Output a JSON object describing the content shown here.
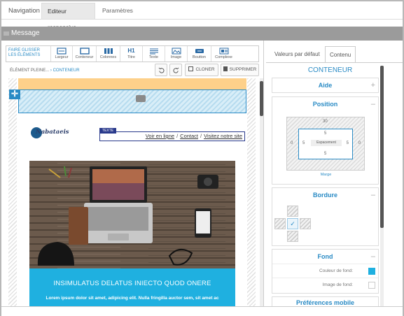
{
  "top_tabs": {
    "navigation": "Navigation",
    "editor": "Editeur responsive",
    "params": "Paramètres"
  },
  "message_bar": {
    "title": "Message"
  },
  "toolbar": {
    "drag_label_line1": "FAIRE GLISSER",
    "drag_label_line2": "LES ÉLÉMENTS",
    "items": [
      {
        "label": "Largeur",
        "icon": "width-icon"
      },
      {
        "label": "Conteneur",
        "icon": "container-icon"
      },
      {
        "label": "Colonnes",
        "icon": "columns-icon"
      },
      {
        "label": "Titre",
        "icon": "heading-icon",
        "glyph": "H1"
      },
      {
        "label": "Texte",
        "icon": "text-icon"
      },
      {
        "label": "Image",
        "icon": "image-icon"
      },
      {
        "label": "Boutton",
        "icon": "button-icon"
      },
      {
        "label": "Complexe",
        "icon": "complex-icon"
      }
    ]
  },
  "breadcrumb": {
    "parent": "ÉLÉMENT PLEINE...",
    "separator": "›",
    "current": "CONTENEUR"
  },
  "actions": {
    "cloner": "CLONER",
    "supprimer": "SUPPRIMER"
  },
  "email": {
    "logo": "Nabataeis",
    "text_badge": "TEXTE",
    "links": [
      "Voir en ligne",
      "Contact",
      "Visitez notre site"
    ],
    "link_separator": "/",
    "headline": "INSIMULATUS DELATUS INIECTO QUOD ONERE",
    "body": "Lorem ipsum dolor sit amet, adipicing elit. Nulla fringilla auctor sem, sit amet ac"
  },
  "right_panel": {
    "tabs": [
      "Valeurs par défaut",
      "Contenu"
    ],
    "title": "CONTENEUR",
    "sections": {
      "aide": "Aide",
      "position": "Position",
      "bordure": "Bordure",
      "fond": "Fond",
      "preferences": "Préférences mobile"
    },
    "position": {
      "outer_top": "30",
      "outer_left": "0",
      "outer_right": "0",
      "inner_top": "5",
      "inner_left": "5",
      "inner_right": "5",
      "inner_bottom": "5",
      "spacing_label": "Espacement",
      "margin_label": "Marge"
    },
    "fond": {
      "color_label": "Couleur de fond:",
      "image_label": "Image de fond:",
      "color": "#1fb0e0"
    }
  },
  "colors": {
    "accent": "#2a8bc5",
    "header_orange": "#fdd08a",
    "hero_blue": "#1fb0e0",
    "bar_grey": "#9b9b9b"
  }
}
